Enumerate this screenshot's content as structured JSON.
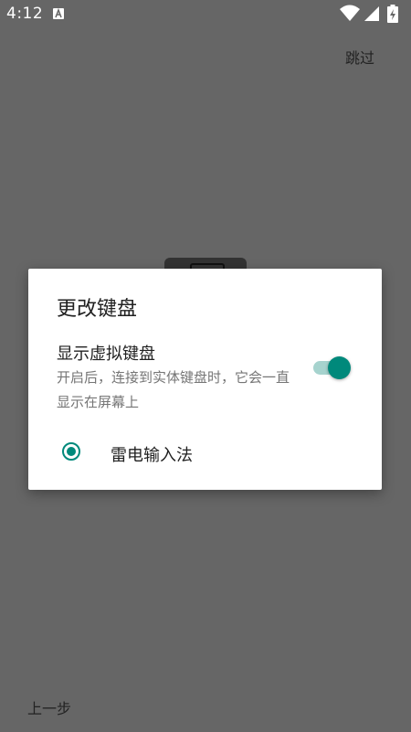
{
  "status_bar": {
    "time": "4:12",
    "icons": [
      "a-notification-icon",
      "wifi-icon",
      "signal-icon",
      "battery-charging-icon"
    ]
  },
  "page": {
    "skip_label": "跳过",
    "prev_label": "上一步"
  },
  "dialog": {
    "title": "更改键盘",
    "virtual_keyboard": {
      "title": "显示虚拟键盘",
      "summary": "开启后，连接到实体键盘时，它会一直显示在屏幕上",
      "enabled": true
    },
    "input_methods": [
      {
        "label": "雷电输入法",
        "selected": true
      }
    ]
  },
  "colors": {
    "accent": "#00897b",
    "toggle_track": "#a6d3ce",
    "scrim": "#666666"
  }
}
